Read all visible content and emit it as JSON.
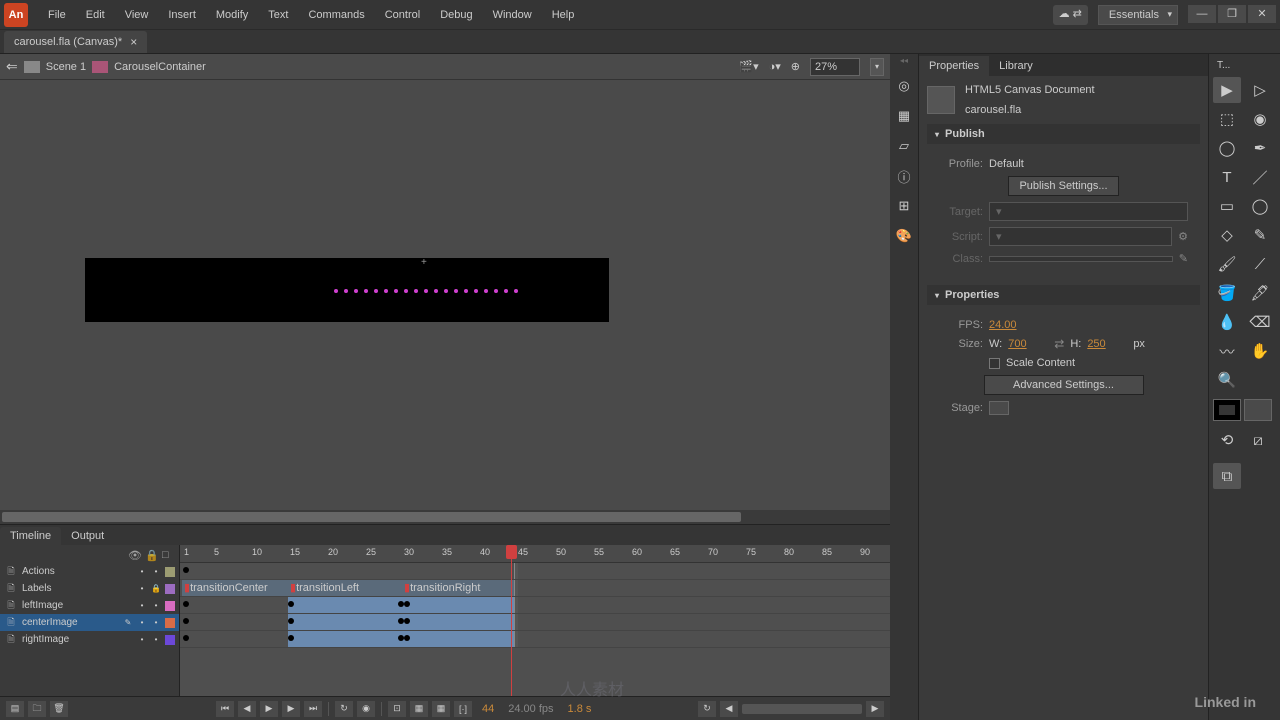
{
  "app_icon_text": "An",
  "menu": [
    "File",
    "Edit",
    "View",
    "Insert",
    "Modify",
    "Text",
    "Commands",
    "Control",
    "Debug",
    "Window",
    "Help"
  ],
  "workspace": "Essentials",
  "doc_tab": "carousel.fla (Canvas)*",
  "edit_bar": {
    "back": "⇐",
    "scene": "Scene 1",
    "symbol": "CarouselContainer",
    "zoom": "27%"
  },
  "timeline": {
    "tabs": [
      "Timeline",
      "Output"
    ],
    "ruler": [
      1,
      5,
      10,
      15,
      20,
      25,
      30,
      35,
      40,
      45,
      50,
      55,
      60,
      65,
      70,
      75,
      80,
      85,
      90
    ],
    "layers": [
      {
        "name": "Actions",
        "ico": "🗎",
        "color": "#9c9c72",
        "locked": false
      },
      {
        "name": "Labels",
        "ico": "🗎",
        "color": "#9c6cc0",
        "locked": true
      },
      {
        "name": "leftImage",
        "ico": "🗎",
        "color": "#d86cc0",
        "locked": false
      },
      {
        "name": "centerImage",
        "ico": "🗎",
        "color": "#d86c48",
        "locked": false,
        "sel": true,
        "pencil": true
      },
      {
        "name": "rightImage",
        "ico": "🗎",
        "color": "#6c48d8",
        "locked": false
      }
    ],
    "labels": [
      "transitionCenter",
      "transitionLeft",
      "transitionRight"
    ],
    "footer": {
      "frame": "44",
      "fps": "24.00 fps",
      "time": "1.8 s"
    }
  },
  "panels": {
    "tabs": [
      "Properties",
      "Library"
    ],
    "doc_type": "HTML5 Canvas Document",
    "doc_name": "carousel.fla",
    "publish": {
      "title": "Publish",
      "profile_label": "Profile:",
      "profile": "Default",
      "settings_btn": "Publish Settings...",
      "target_label": "Target:",
      "script_label": "Script:",
      "class_label": "Class:"
    },
    "props": {
      "title": "Properties",
      "fps_label": "FPS:",
      "fps": "24.00",
      "size_label": "Size:",
      "w_label": "W:",
      "w": "700",
      "h_label": "H:",
      "h": "250",
      "px": "px",
      "scale_label": "Scale Content",
      "adv_btn": "Advanced Settings...",
      "stage_label": "Stage:"
    }
  },
  "tools_tab": "T...",
  "watermark": "人人素材",
  "linkedin": "Linked in"
}
